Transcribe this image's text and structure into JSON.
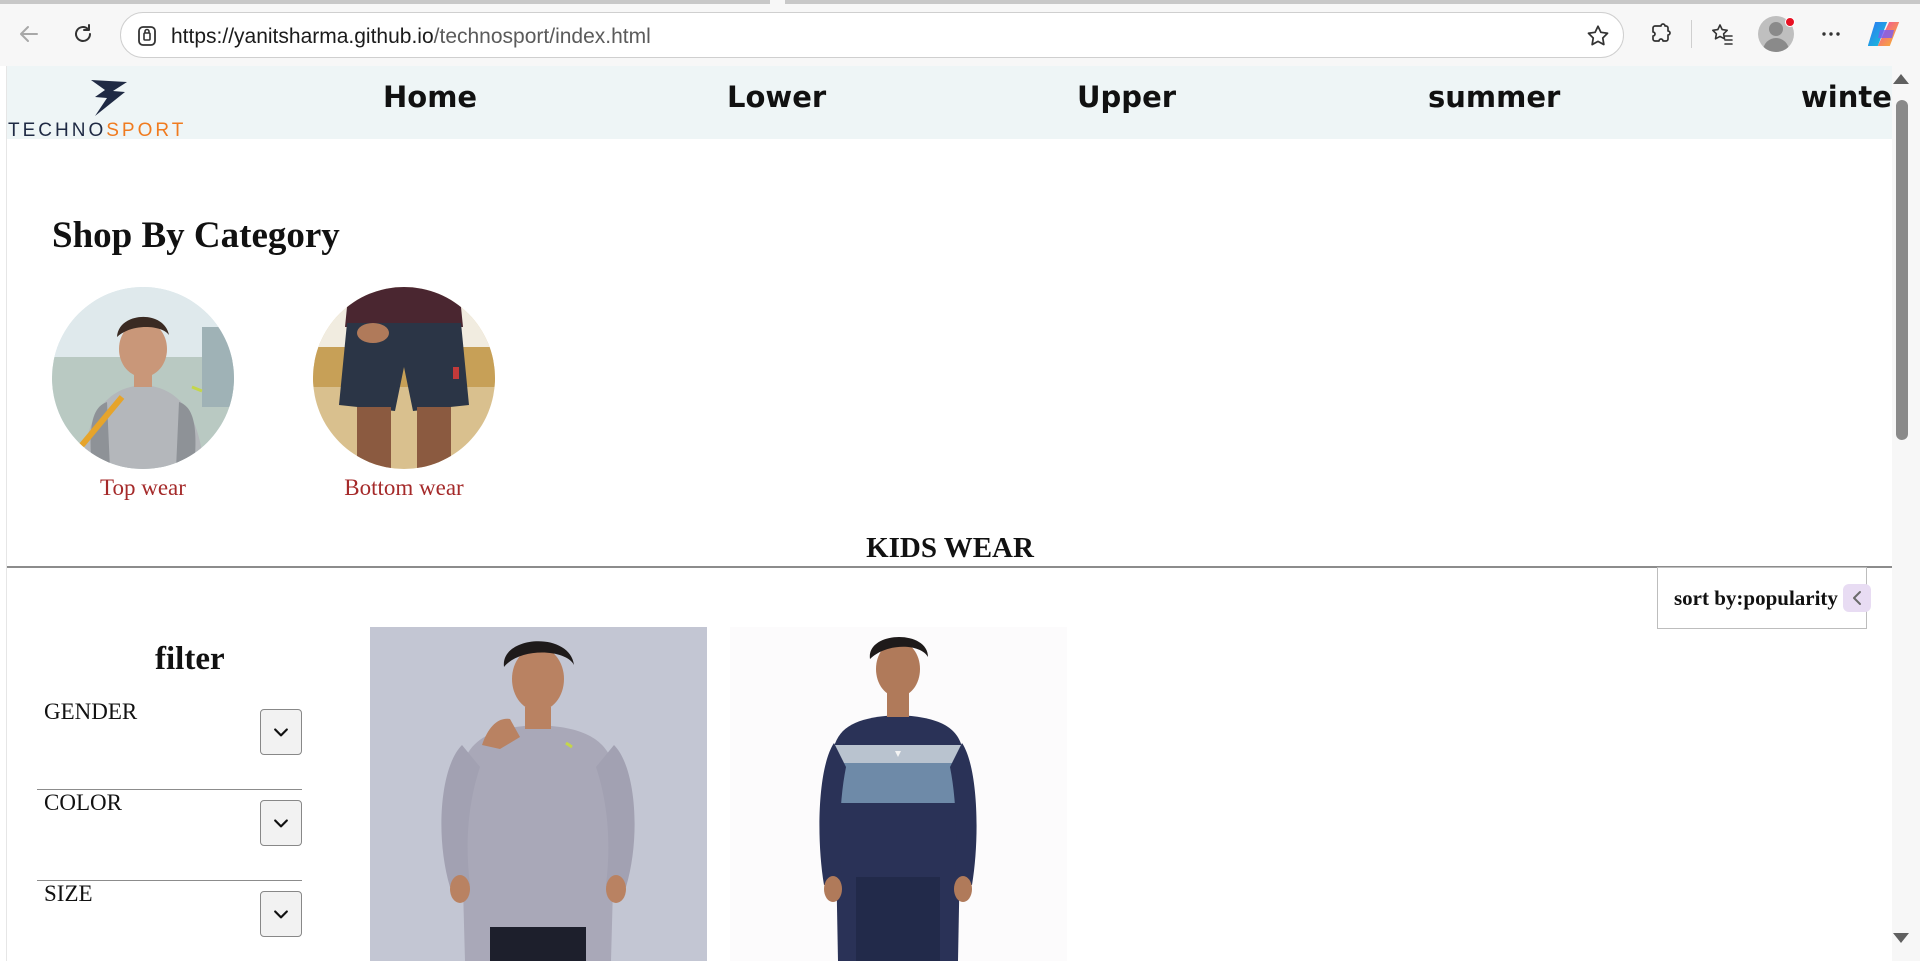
{
  "browser": {
    "url_host": "https://yanitsharma.github.io",
    "url_path": "/technosport/index.html",
    "icons": [
      "back-arrow-icon",
      "refresh-icon",
      "lock-icon",
      "star-icon",
      "extensions-icon",
      "favorites-icon",
      "profile-icon",
      "more-icon",
      "copilot-icon"
    ]
  },
  "site": {
    "logo": {
      "part1": "TECHNO",
      "part2": "SPORT"
    },
    "nav": [
      "Home",
      "Lower",
      "Upper",
      "summer",
      "winter"
    ]
  },
  "categories": {
    "heading": "Shop By Category",
    "items": [
      {
        "label": "Top wear"
      },
      {
        "label": "Bottom wear"
      }
    ]
  },
  "section": {
    "title": "KIDS WEAR",
    "sort_label": "sort by:popularity"
  },
  "filter": {
    "title": "filter",
    "groups": [
      "GENDER",
      "COLOR",
      "SIZE"
    ]
  },
  "colors": {
    "header_bg": "#eef5f6",
    "category_label": "#a52a2a",
    "logo_navy": "#1f2a44",
    "logo_orange": "#f07b1f"
  }
}
